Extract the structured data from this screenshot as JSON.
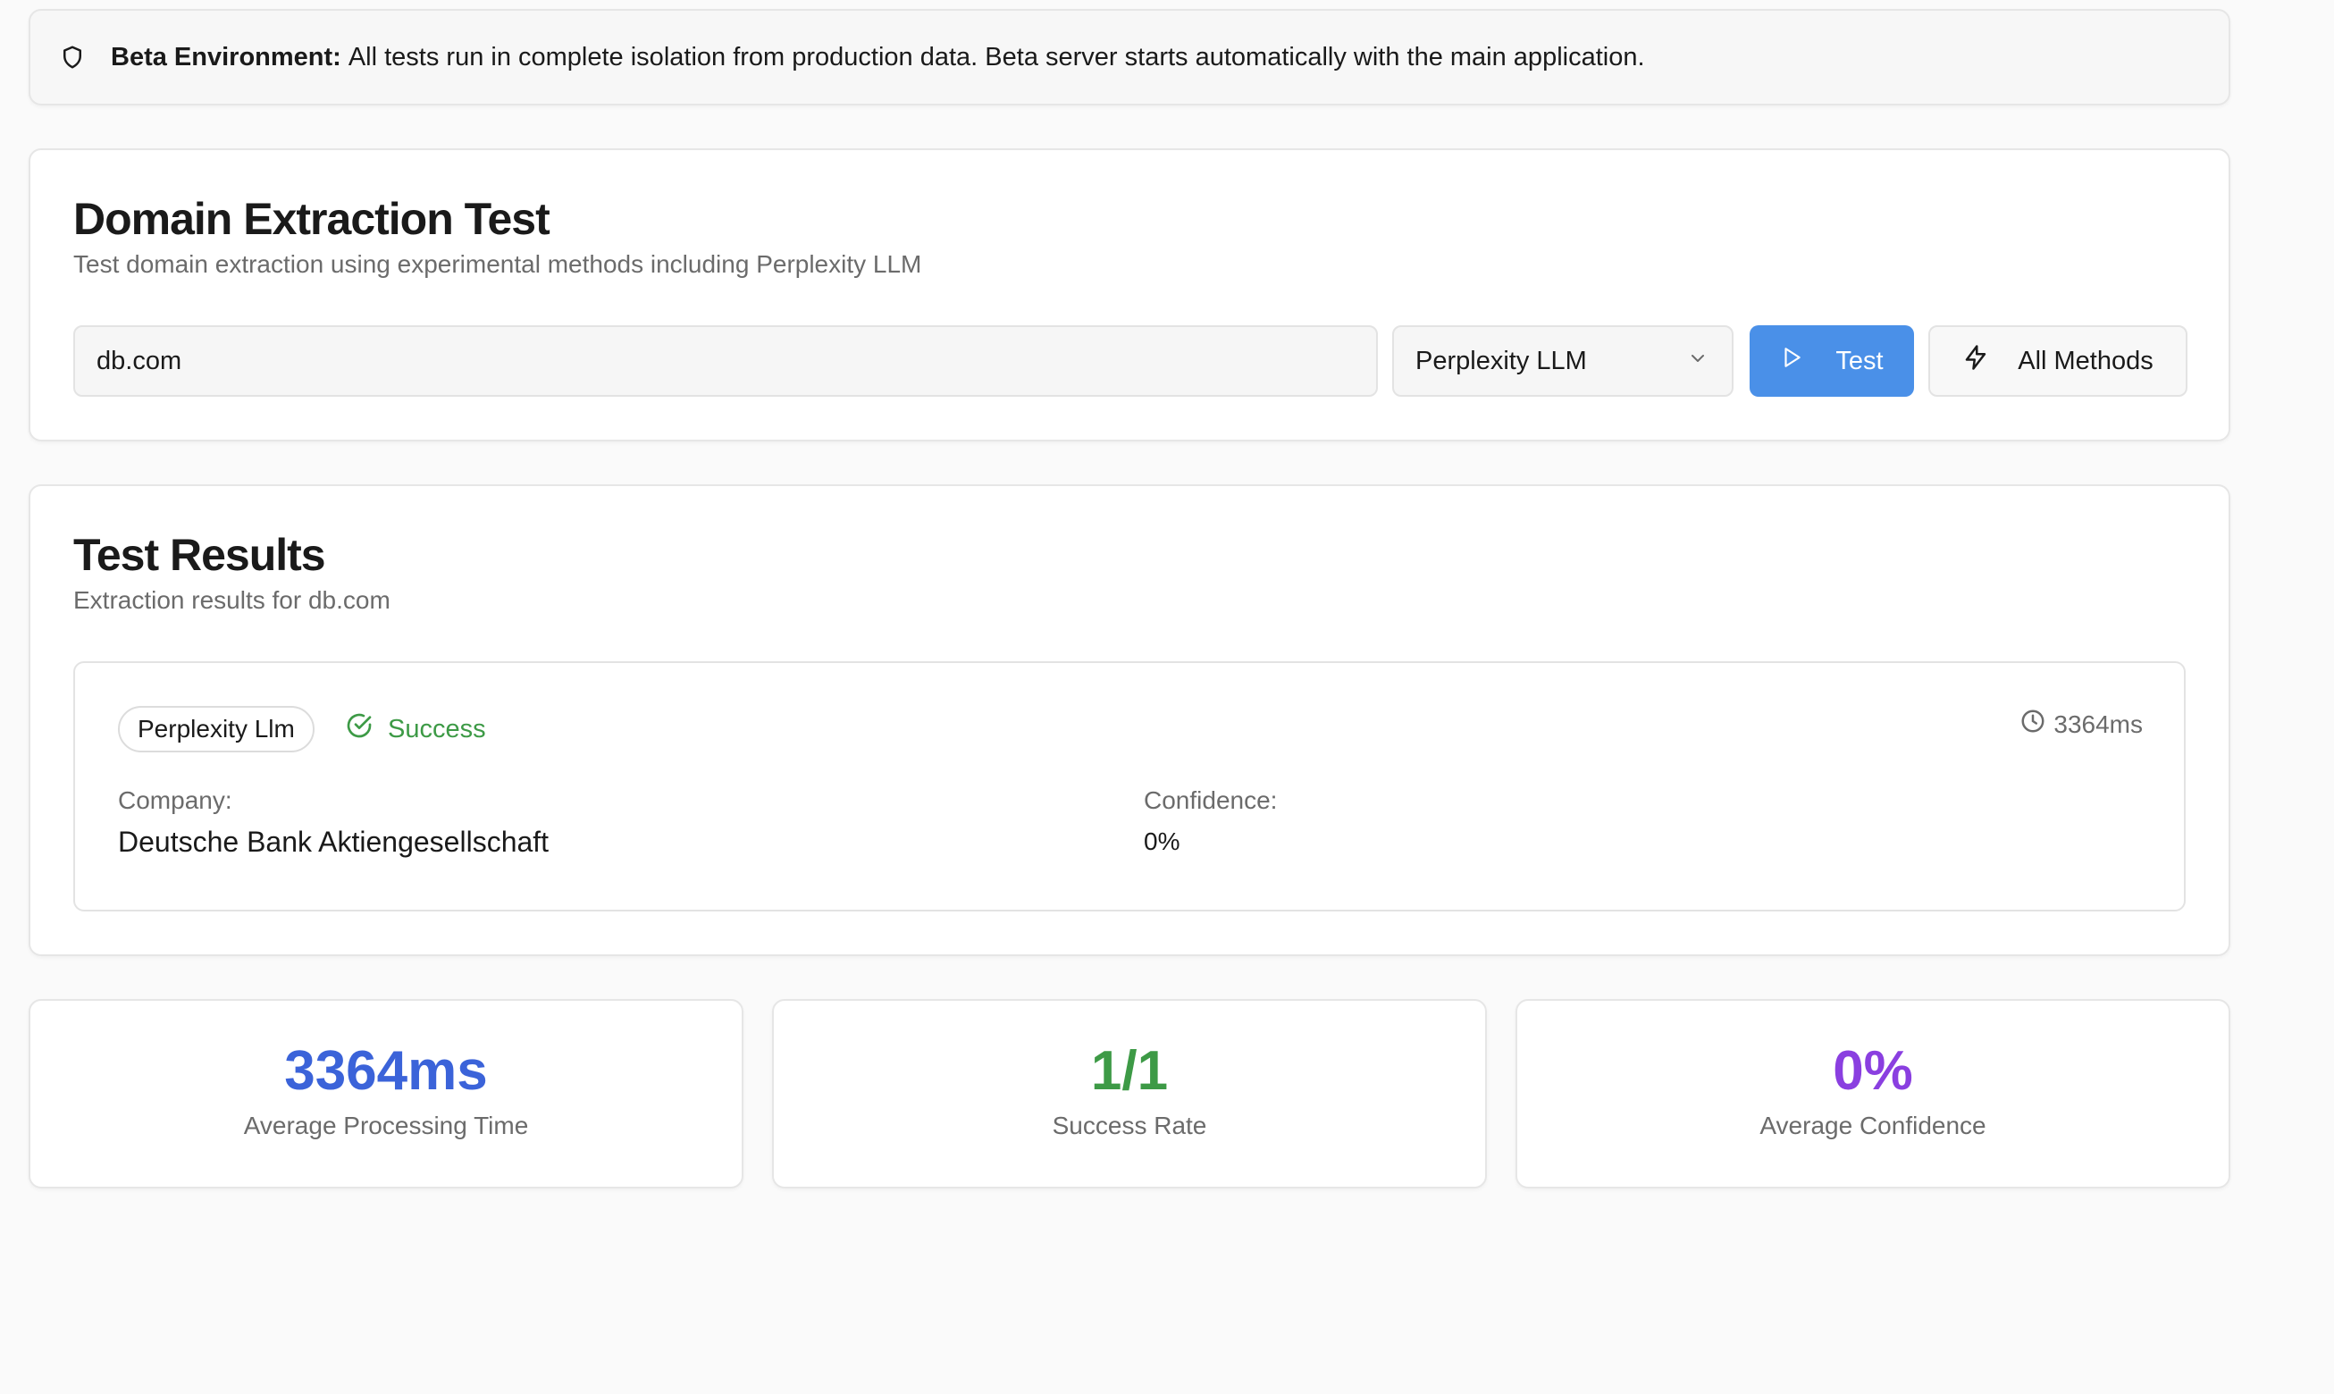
{
  "banner": {
    "title": "Beta Environment:",
    "message": "All tests run in complete isolation from production data. Beta server starts automatically with the main application."
  },
  "extraction": {
    "title": "Domain Extraction Test",
    "subtitle": "Test domain extraction using experimental methods including Perplexity LLM",
    "domain_value": "db.com",
    "method_selected": "Perplexity LLM",
    "test_label": "Test",
    "all_methods_label": "All Methods"
  },
  "results": {
    "title": "Test Results",
    "subtitle": "Extraction results for db.com",
    "items": [
      {
        "method": "Perplexity Llm",
        "status": "Success",
        "duration": "3364ms",
        "company_label": "Company:",
        "company": "Deutsche Bank Aktiengesellschaft",
        "confidence_label": "Confidence:",
        "confidence": "0%"
      }
    ]
  },
  "stats": {
    "avg_time": {
      "value": "3364ms",
      "label": "Average Processing Time",
      "color": "#3b63d9"
    },
    "success_rate": {
      "value": "1/1",
      "label": "Success Rate",
      "color": "#3d9a46"
    },
    "avg_confidence": {
      "value": "0%",
      "label": "Average Confidence",
      "color": "#8a3fe0"
    }
  },
  "icons": {
    "banner": "shield-icon",
    "select": "chevron-down-icon",
    "test": "play-icon",
    "all_methods": "zap-icon",
    "status": "check-circle-icon",
    "duration": "clock-icon"
  }
}
